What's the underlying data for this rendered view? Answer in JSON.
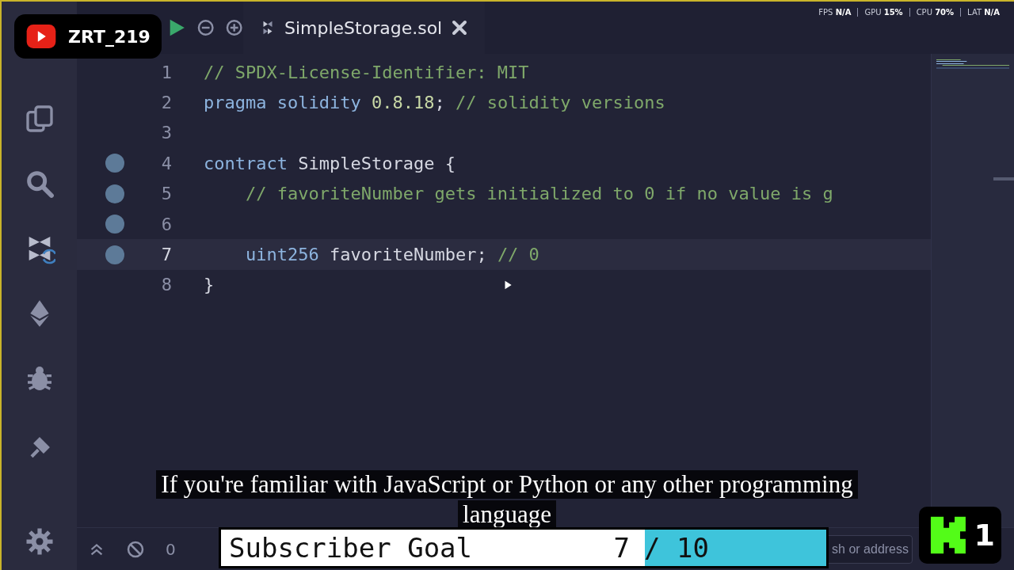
{
  "tab": {
    "label": "SimpleStorage.sol",
    "selected": true
  },
  "editor": {
    "lines": [
      {
        "number": "1",
        "active": false,
        "breakpoint": false,
        "tokens": [
          {
            "kind": "comment",
            "text": "// SPDX-License-Identifier: MIT"
          }
        ]
      },
      {
        "number": "2",
        "active": false,
        "breakpoint": false,
        "tokens": [
          {
            "kind": "keyword",
            "text": "pragma solidity "
          },
          {
            "kind": "number",
            "text": "0.8.18"
          },
          {
            "kind": "plain",
            "text": "; "
          },
          {
            "kind": "comment",
            "text": "// solidity versions"
          }
        ]
      },
      {
        "number": "3",
        "active": false,
        "breakpoint": false
      },
      {
        "number": "4",
        "active": false,
        "breakpoint": true,
        "tokens": [
          {
            "kind": "keyword",
            "text": "contract "
          },
          {
            "kind": "plain",
            "text": "SimpleStorage {"
          }
        ]
      },
      {
        "number": "5",
        "active": false,
        "breakpoint": true,
        "tokens": [
          {
            "kind": "comment",
            "text": "    // favoriteNumber gets initialized to 0 if no value is g"
          }
        ]
      },
      {
        "number": "6",
        "active": false,
        "breakpoint": true
      },
      {
        "number": "7",
        "active": true,
        "breakpoint": true,
        "tokens": [
          {
            "kind": "keyword",
            "text": "    uint256 "
          },
          {
            "kind": "plain",
            "text": "favoriteNumber; "
          },
          {
            "kind": "comment",
            "text": "// 0"
          }
        ]
      },
      {
        "number": "8",
        "active": false,
        "breakpoint": false,
        "tokens": [
          {
            "kind": "plain",
            "text": "}"
          }
        ]
      }
    ]
  },
  "status_bar": {
    "count": "0",
    "search": {
      "placeholder": "sh or address"
    }
  },
  "overlays": {
    "channel": "ZRT_219",
    "stats": [
      {
        "label": "FPS",
        "value": "N/A"
      },
      {
        "label": "GPU",
        "value": "15%"
      },
      {
        "label": "CPU",
        "value": "70%"
      },
      {
        "label": "LAT",
        "value": "N/A"
      }
    ],
    "caption": [
      "If you're familiar with JavaScript or Python or any other programming",
      "language"
    ],
    "goal": {
      "label": "Subscriber Goal",
      "current": "7",
      "total": "/ 10",
      "level": 0.7
    },
    "kick_count": "1"
  }
}
